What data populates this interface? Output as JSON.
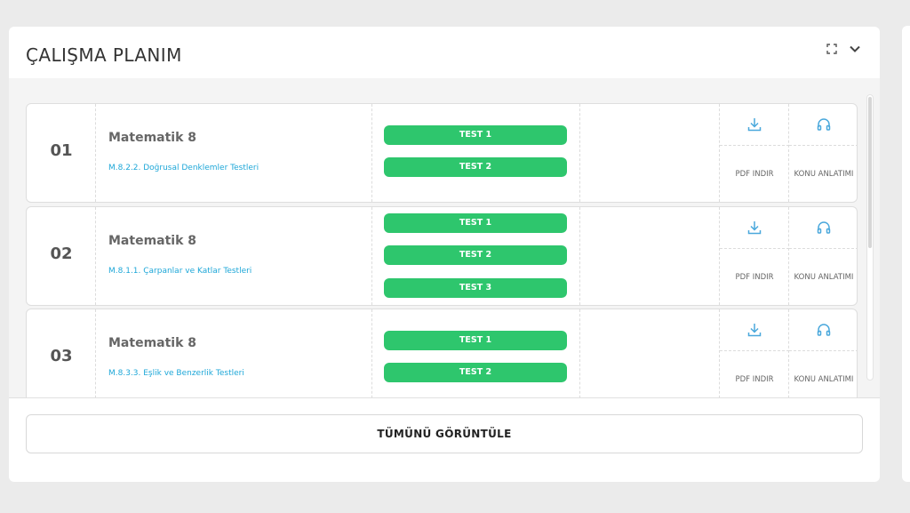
{
  "panel": {
    "title": "ÇALIŞMA PLANIM",
    "icons": {
      "expand": "fullscreen-icon",
      "collapse": "chevron-down-icon"
    }
  },
  "rows": [
    {
      "number": "01",
      "subject": "Matematik 8",
      "topic": "M.8.2.2. Doğrusal Denklemler Testleri",
      "tests": [
        "TEST 1",
        "TEST 2"
      ],
      "pdf_label": "PDF İNDİR",
      "konu_label": "KONU ANLATIMI"
    },
    {
      "number": "02",
      "subject": "Matematik 8",
      "topic": "M.8.1.1. Çarpanlar ve Katlar Testleri",
      "tests": [
        "TEST 1",
        "TEST 2",
        "TEST 3"
      ],
      "pdf_label": "PDF İNDİR",
      "konu_label": "KONU ANLATIMI"
    },
    {
      "number": "03",
      "subject": "Matematik 8",
      "topic": "M.8.3.3. Eşlik ve Benzerlik Testleri",
      "tests": [
        "TEST 1",
        "TEST 2"
      ],
      "pdf_label": "PDF İNDİR",
      "konu_label": "KONU ANLATIMI"
    }
  ],
  "footer": {
    "view_all_label": "TÜMÜNÜ GÖRÜNTÜLE"
  },
  "colors": {
    "test_button": "#2ec66d",
    "link": "#1ea7d8",
    "icon": "#4aa8dc"
  }
}
